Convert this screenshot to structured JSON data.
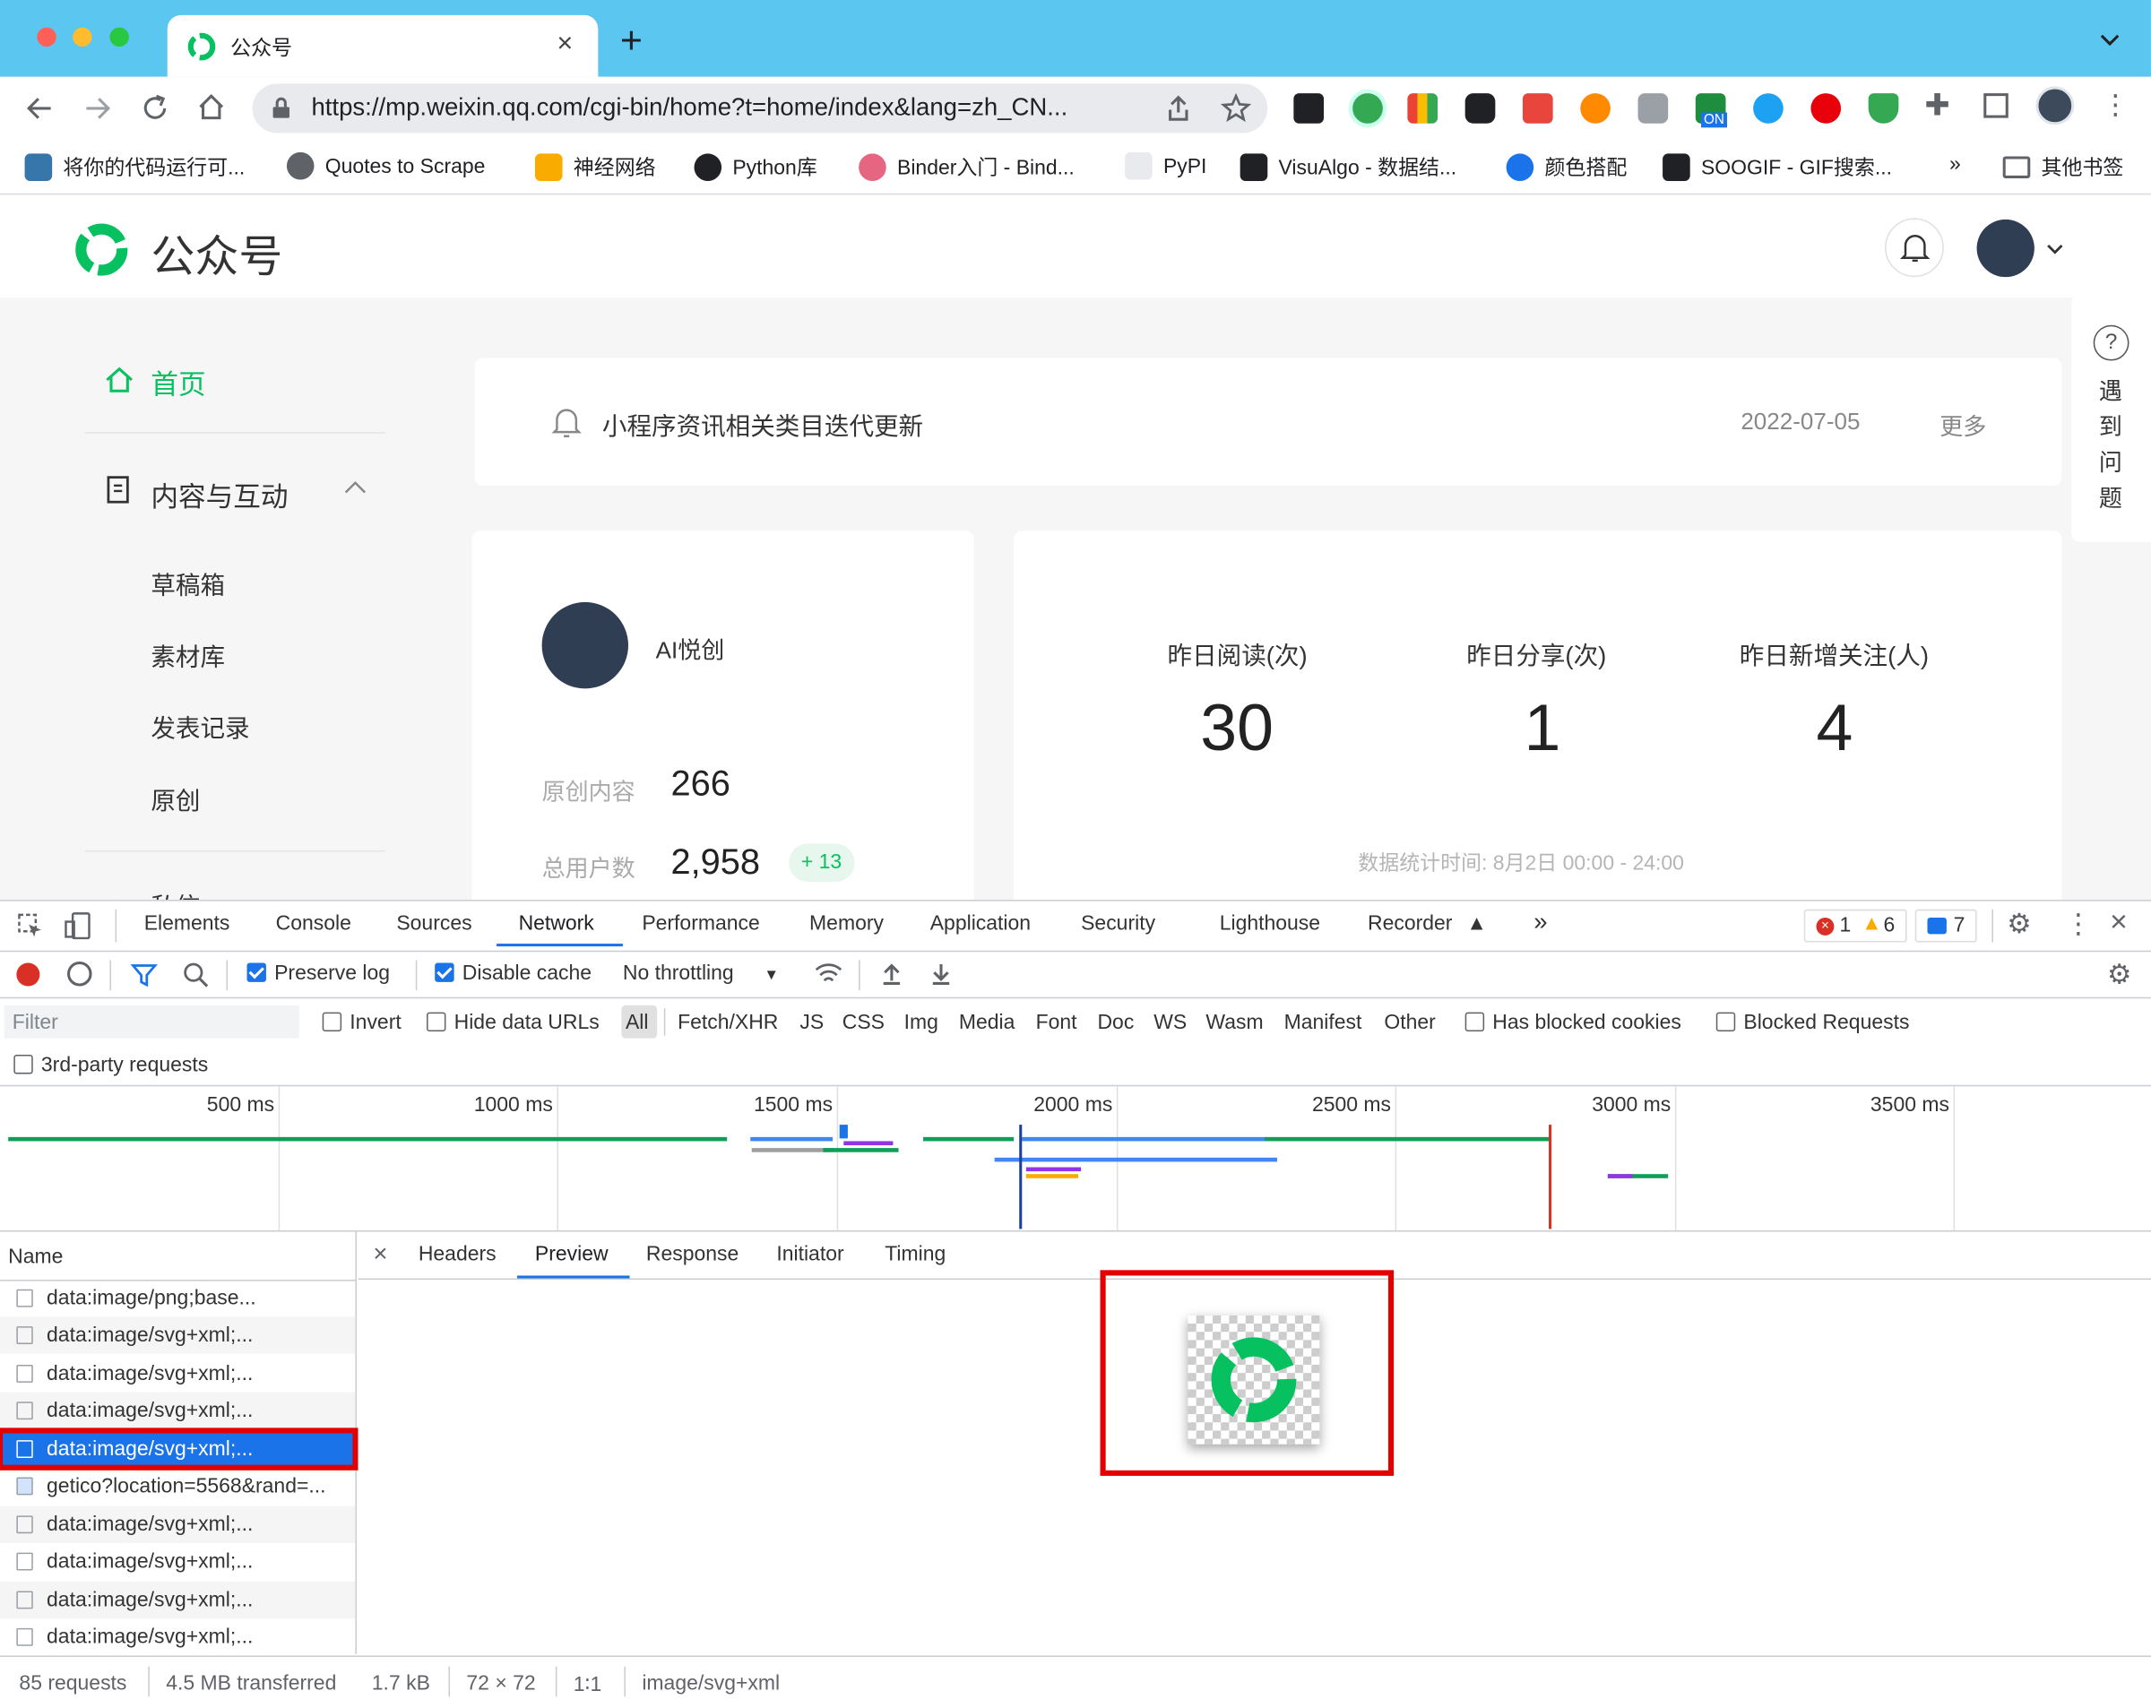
{
  "browser": {
    "tab_title": "公众号",
    "url": "https://mp.weixin.qq.com/cgi-bin/home?t=home/index&lang=zh_CN...",
    "bookmarks": [
      "将你的代码运行可...",
      "Quotes to Scrape",
      "神经网络",
      "Python库",
      "Binder入门 - Bind...",
      "PyPI",
      "VisuAlgo - 数据结...",
      "颜色搭配",
      "SOOGIF - GIF搜索..."
    ],
    "bookmarks_more": "»",
    "other_bookmarks": "其他书签",
    "ext_badge": "ON"
  },
  "site": {
    "logo_text": "公众号",
    "help_text": "遇到问题",
    "nav": {
      "home": "首页",
      "content_interaction": "内容与互动",
      "drafts": "草稿箱",
      "library": "素材库",
      "publish_history": "发表记录",
      "original": "原创",
      "partial": "私信"
    },
    "notice": {
      "text": "小程序资讯相关类目迭代更新",
      "date": "2022-07-05",
      "more": "更多"
    },
    "account": {
      "name": "AI悦创",
      "original_label": "原创内容",
      "original_value": "266",
      "users_label": "总用户数",
      "users_value": "2,958",
      "users_delta": "+ 13"
    },
    "stats": {
      "read_label": "昨日阅读(次)",
      "read_value": "30",
      "share_label": "昨日分享(次)",
      "share_value": "1",
      "follow_label": "昨日新增关注(人)",
      "follow_value": "4",
      "time_note": "数据统计时间: 8月2日 00:00 - 24:00"
    }
  },
  "devtools": {
    "tabs": [
      "Elements",
      "Console",
      "Sources",
      "Network",
      "Performance",
      "Memory",
      "Application",
      "Security",
      "Lighthouse",
      "Recorder"
    ],
    "active_tab": "Network",
    "more_tabs": "»",
    "errors": "1",
    "warnings": "6",
    "messages": "7",
    "preserve_log": "Preserve log",
    "disable_cache": "Disable cache",
    "throttling": "No throttling",
    "filter_placeholder": "Filter",
    "invert": "Invert",
    "hide_data_urls": "Hide data URLs",
    "type_filters": [
      "All",
      "Fetch/XHR",
      "JS",
      "CSS",
      "Img",
      "Media",
      "Font",
      "Doc",
      "WS",
      "Wasm",
      "Manifest",
      "Other"
    ],
    "has_blocked_cookies": "Has blocked cookies",
    "blocked_requests": "Blocked Requests",
    "third_party": "3rd-party requests",
    "timeline_ticks": [
      "500 ms",
      "1000 ms",
      "1500 ms",
      "2000 ms",
      "2500 ms",
      "3000 ms",
      "3500 ms"
    ],
    "name_header": "Name",
    "requests": [
      "data:image/png;base...",
      "data:image/svg+xml;...",
      "data:image/svg+xml;...",
      "data:image/svg+xml;...",
      "data:image/svg+xml;...",
      "getico?location=5568&rand=...",
      "data:image/svg+xml;...",
      "data:image/svg+xml;...",
      "data:image/svg+xml;...",
      "data:image/svg+xml;..."
    ],
    "selected_index": 4,
    "panel_tabs": [
      "Headers",
      "Preview",
      "Response",
      "Initiator",
      "Timing"
    ],
    "panel_active": "Preview",
    "status": {
      "requests": "85 requests",
      "transferred": "4.5 MB transferred",
      "size": "1.7 kB",
      "dims": "72 × 72",
      "ratio": "1∶1",
      "mime": "image/svg+xml"
    },
    "colors": {
      "accent": "#1a73e8",
      "highlight": "#ff0000",
      "brand_green": "#07c160"
    }
  }
}
